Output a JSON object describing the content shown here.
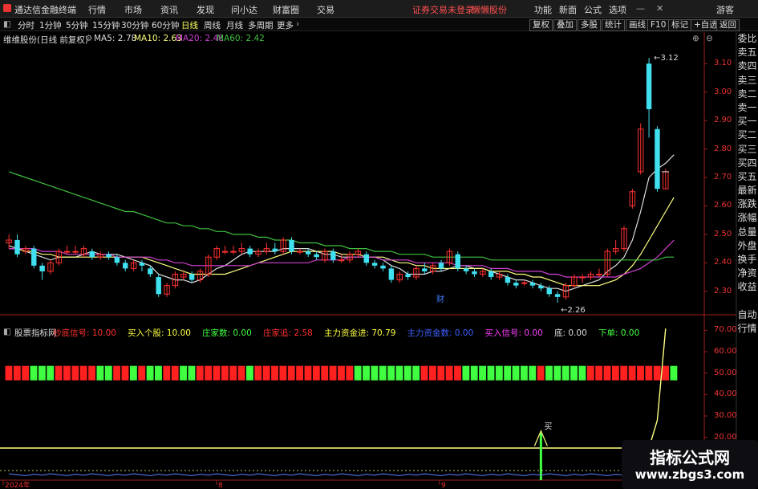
{
  "menubar": {
    "app_title": "通达信金融终端",
    "menus": [
      "行情",
      "市场",
      "资讯",
      "发现",
      "问小达",
      "财富圈",
      "交易"
    ],
    "status_text": "证券交易未登录",
    "user_text": "懒懒股份",
    "right_items": [
      "功能",
      "新面",
      "公式",
      "选项"
    ],
    "guest": "游客"
  },
  "tabs": {
    "periods": [
      "分时",
      "1分钟",
      "5分钟",
      "15分钟",
      "30分钟",
      "60分钟",
      "日线",
      "周线",
      "月线",
      "多周期",
      "更多"
    ],
    "active": "日线",
    "right_buttons": [
      "复权",
      "叠加",
      "多股",
      "统计",
      "画线",
      "F10",
      "标记",
      "+自选",
      "返回"
    ]
  },
  "infobar": {
    "stock": "维维股份(日线 前复权)",
    "ma5": "MA5: 2.78",
    "ma10": "MA10: 2.63",
    "ma20": "MA20: 2.48",
    "ma60": "MA60: 2.42"
  },
  "sidepanel": [
    "委比",
    "卖五",
    "卖四",
    "卖三",
    "卖二",
    "卖一",
    "买一",
    "买二",
    "买三",
    "买四",
    "买五",
    "最新",
    "涨跌",
    "涨幅",
    "总量",
    "外盘",
    "换手",
    "净资",
    "收益"
  ],
  "sidepanel2": [
    "自动",
    "行情"
  ],
  "indicator": {
    "name": "股票指标网",
    "items": [
      {
        "label": "抄底信号:",
        "value": "10.00",
        "color": "#ff3030"
      },
      {
        "label": "买入个股:",
        "value": "10.00",
        "color": "#ffff40"
      },
      {
        "label": "庄家数:",
        "value": "0.00",
        "color": "#40ff40"
      },
      {
        "label": "庄家追:",
        "value": "2.58",
        "color": "#ff3030"
      },
      {
        "label": "主力资金进:",
        "value": "70.79",
        "color": "#ffff40"
      },
      {
        "label": "主力资金数:",
        "value": "0.00",
        "color": "#4060ff"
      },
      {
        "label": "买入信号:",
        "value": "0.00",
        "color": "#ff40ff"
      },
      {
        "label": "底:",
        "value": "0.00",
        "color": "#dddddd"
      },
      {
        "label": "下单:",
        "value": "0.00",
        "color": "#40ff40"
      }
    ]
  },
  "price_axis": [
    "3.10",
    "3.00",
    "2.90",
    "2.80",
    "2.70",
    "2.60",
    "2.50",
    "2.40",
    "2.30"
  ],
  "ind_axis": [
    "70.00",
    "60.00",
    "50.00",
    "40.00",
    "30.00",
    "20.00"
  ],
  "annotations": {
    "high": "3.12",
    "low": "2.26",
    "cai": "财",
    "buy": "买"
  },
  "date_axis": [
    "2024年",
    "8",
    "9"
  ],
  "watermark": {
    "line1": "指标公式网",
    "line2": "www.zbgs3.com"
  },
  "colors": {
    "up": "#ff3030",
    "down": "#40e0f0",
    "ma5": "#dddddd",
    "ma10": "#ffff80",
    "ma20": "#d040d0",
    "ma60": "#40c040",
    "axis": "#ff3030"
  },
  "chart_data": {
    "type": "candlestick",
    "ylim": [
      2.24,
      3.16
    ],
    "candles": [
      [
        2.47,
        2.48,
        2.5,
        2.45
      ],
      [
        2.48,
        2.43,
        2.5,
        2.42
      ],
      [
        2.44,
        2.45,
        2.46,
        2.43
      ],
      [
        2.45,
        2.39,
        2.46,
        2.38
      ],
      [
        2.39,
        2.37,
        2.4,
        2.34
      ],
      [
        2.37,
        2.4,
        2.41,
        2.36
      ],
      [
        2.4,
        2.44,
        2.45,
        2.39
      ],
      [
        2.44,
        2.44,
        2.46,
        2.43
      ],
      [
        2.44,
        2.44,
        2.46,
        2.43
      ],
      [
        2.43,
        2.45,
        2.46,
        2.42
      ],
      [
        2.44,
        2.42,
        2.45,
        2.41
      ],
      [
        2.42,
        2.43,
        2.44,
        2.41
      ],
      [
        2.43,
        2.42,
        2.44,
        2.41
      ],
      [
        2.42,
        2.4,
        2.43,
        2.39
      ],
      [
        2.4,
        2.38,
        2.41,
        2.37
      ],
      [
        2.38,
        2.4,
        2.41,
        2.37
      ],
      [
        2.4,
        2.39,
        2.41,
        2.37
      ],
      [
        2.38,
        2.36,
        2.39,
        2.35
      ],
      [
        2.35,
        2.29,
        2.36,
        2.28
      ],
      [
        2.29,
        2.32,
        2.33,
        2.28
      ],
      [
        2.32,
        2.36,
        2.37,
        2.31
      ],
      [
        2.35,
        2.36,
        2.37,
        2.34
      ],
      [
        2.36,
        2.34,
        2.37,
        2.33
      ],
      [
        2.34,
        2.37,
        2.38,
        2.33
      ],
      [
        2.36,
        2.42,
        2.43,
        2.35
      ],
      [
        2.42,
        2.45,
        2.46,
        2.41
      ],
      [
        2.44,
        2.44,
        2.46,
        2.43
      ],
      [
        2.44,
        2.44,
        2.46,
        2.43
      ],
      [
        2.44,
        2.45,
        2.47,
        2.43
      ],
      [
        2.45,
        2.43,
        2.46,
        2.42
      ],
      [
        2.43,
        2.44,
        2.45,
        2.42
      ],
      [
        2.44,
        2.45,
        2.47,
        2.43
      ],
      [
        2.45,
        2.44,
        2.47,
        2.43
      ],
      [
        2.44,
        2.48,
        2.49,
        2.43
      ],
      [
        2.48,
        2.44,
        2.49,
        2.43
      ],
      [
        2.44,
        2.44,
        2.45,
        2.43
      ],
      [
        2.44,
        2.43,
        2.45,
        2.42
      ],
      [
        2.43,
        2.42,
        2.44,
        2.41
      ],
      [
        2.41,
        2.44,
        2.45,
        2.4
      ],
      [
        2.44,
        2.41,
        2.45,
        2.4
      ],
      [
        2.41,
        2.41,
        2.43,
        2.4
      ],
      [
        2.41,
        2.43,
        2.44,
        2.4
      ],
      [
        2.43,
        2.44,
        2.45,
        2.42
      ],
      [
        2.43,
        2.4,
        2.44,
        2.39
      ],
      [
        2.4,
        2.39,
        2.41,
        2.38
      ],
      [
        2.39,
        2.38,
        2.4,
        2.37
      ],
      [
        2.38,
        2.34,
        2.39,
        2.33
      ],
      [
        2.34,
        2.36,
        2.37,
        2.33
      ],
      [
        2.36,
        2.35,
        2.37,
        2.34
      ],
      [
        2.35,
        2.38,
        2.39,
        2.34
      ],
      [
        2.38,
        2.37,
        2.4,
        2.36
      ],
      [
        2.37,
        2.39,
        2.4,
        2.36
      ],
      [
        2.4,
        2.38,
        2.41,
        2.37
      ],
      [
        2.4,
        2.44,
        2.45,
        2.39
      ],
      [
        2.43,
        2.38,
        2.44,
        2.37
      ],
      [
        2.38,
        2.37,
        2.39,
        2.36
      ],
      [
        2.37,
        2.36,
        2.38,
        2.35
      ],
      [
        2.36,
        2.37,
        2.38,
        2.35
      ],
      [
        2.37,
        2.35,
        2.38,
        2.34
      ],
      [
        2.35,
        2.36,
        2.37,
        2.34
      ],
      [
        2.35,
        2.33,
        2.36,
        2.32
      ],
      [
        2.33,
        2.32,
        2.34,
        2.31
      ],
      [
        2.33,
        2.33,
        2.34,
        2.32
      ],
      [
        2.33,
        2.32,
        2.34,
        2.31
      ],
      [
        2.32,
        2.31,
        2.33,
        2.3
      ],
      [
        2.31,
        2.29,
        2.32,
        2.28
      ],
      [
        2.29,
        2.28,
        2.3,
        2.26
      ],
      [
        2.28,
        2.32,
        2.33,
        2.27
      ],
      [
        2.32,
        2.35,
        2.36,
        2.31
      ],
      [
        2.35,
        2.35,
        2.36,
        2.33
      ],
      [
        2.35,
        2.36,
        2.37,
        2.34
      ],
      [
        2.36,
        2.36,
        2.38,
        2.35
      ],
      [
        2.36,
        2.44,
        2.45,
        2.35
      ],
      [
        2.44,
        2.45,
        2.48,
        2.43
      ],
      [
        2.45,
        2.52,
        2.53,
        2.44
      ],
      [
        2.6,
        2.65,
        2.66,
        2.59
      ],
      [
        2.72,
        2.87,
        2.89,
        2.71
      ],
      [
        3.1,
        2.94,
        3.12,
        2.84
      ],
      [
        2.87,
        2.66,
        2.88,
        2.65
      ],
      [
        2.66,
        2.72,
        2.73,
        2.66
      ]
    ],
    "ma_series": [
      {
        "name": "MA5",
        "values": [
          2.46,
          2.45,
          2.44,
          2.43,
          2.42,
          2.41,
          2.42,
          2.42,
          2.42,
          2.43,
          2.44,
          2.43,
          2.43,
          2.43,
          2.42,
          2.41,
          2.4,
          2.39,
          2.36,
          2.35,
          2.34,
          2.34,
          2.33,
          2.34,
          2.36,
          2.38,
          2.39,
          2.41,
          2.43,
          2.44,
          2.44,
          2.44,
          2.44,
          2.45,
          2.45,
          2.45,
          2.45,
          2.44,
          2.43,
          2.43,
          2.42,
          2.42,
          2.42,
          2.42,
          2.42,
          2.41,
          2.39,
          2.38,
          2.36,
          2.36,
          2.36,
          2.37,
          2.37,
          2.38,
          2.39,
          2.39,
          2.38,
          2.38,
          2.37,
          2.36,
          2.35,
          2.34,
          2.34,
          2.33,
          2.32,
          2.31,
          2.31,
          2.3,
          2.31,
          2.32,
          2.33,
          2.34,
          2.37,
          2.39,
          2.42,
          2.48,
          2.58,
          2.7,
          2.73,
          2.75,
          2.78
        ]
      },
      {
        "name": "MA10",
        "values": [
          2.45,
          2.45,
          2.44,
          2.44,
          2.43,
          2.43,
          2.42,
          2.42,
          2.42,
          2.42,
          2.42,
          2.42,
          2.42,
          2.42,
          2.42,
          2.42,
          2.42,
          2.41,
          2.4,
          2.39,
          2.38,
          2.37,
          2.36,
          2.36,
          2.36,
          2.36,
          2.36,
          2.37,
          2.38,
          2.39,
          2.4,
          2.41,
          2.42,
          2.43,
          2.44,
          2.44,
          2.44,
          2.44,
          2.44,
          2.44,
          2.43,
          2.43,
          2.43,
          2.42,
          2.42,
          2.42,
          2.41,
          2.4,
          2.4,
          2.39,
          2.39,
          2.38,
          2.38,
          2.38,
          2.38,
          2.38,
          2.38,
          2.38,
          2.37,
          2.37,
          2.37,
          2.36,
          2.36,
          2.35,
          2.35,
          2.34,
          2.33,
          2.32,
          2.32,
          2.32,
          2.32,
          2.32,
          2.33,
          2.34,
          2.36,
          2.39,
          2.43,
          2.48,
          2.53,
          2.58,
          2.63
        ]
      },
      {
        "name": "MA20",
        "values": [
          2.45,
          2.45,
          2.45,
          2.45,
          2.44,
          2.44,
          2.44,
          2.43,
          2.43,
          2.43,
          2.43,
          2.43,
          2.43,
          2.42,
          2.42,
          2.42,
          2.42,
          2.42,
          2.41,
          2.41,
          2.4,
          2.4,
          2.39,
          2.39,
          2.39,
          2.39,
          2.39,
          2.39,
          2.39,
          2.39,
          2.4,
          2.4,
          2.4,
          2.4,
          2.4,
          2.4,
          2.4,
          2.41,
          2.41,
          2.41,
          2.41,
          2.42,
          2.42,
          2.42,
          2.42,
          2.41,
          2.41,
          2.41,
          2.41,
          2.4,
          2.4,
          2.4,
          2.4,
          2.4,
          2.39,
          2.39,
          2.39,
          2.39,
          2.38,
          2.38,
          2.38,
          2.37,
          2.37,
          2.37,
          2.37,
          2.36,
          2.36,
          2.35,
          2.35,
          2.35,
          2.35,
          2.35,
          2.35,
          2.35,
          2.36,
          2.37,
          2.38,
          2.4,
          2.42,
          2.45,
          2.48
        ]
      },
      {
        "name": "MA60",
        "values": [
          2.72,
          2.71,
          2.7,
          2.69,
          2.68,
          2.67,
          2.66,
          2.65,
          2.64,
          2.63,
          2.62,
          2.61,
          2.6,
          2.59,
          2.58,
          2.58,
          2.57,
          2.56,
          2.55,
          2.54,
          2.54,
          2.53,
          2.53,
          2.52,
          2.52,
          2.51,
          2.51,
          2.5,
          2.5,
          2.5,
          2.49,
          2.49,
          2.48,
          2.48,
          2.48,
          2.47,
          2.47,
          2.47,
          2.46,
          2.46,
          2.46,
          2.45,
          2.45,
          2.45,
          2.44,
          2.44,
          2.44,
          2.43,
          2.43,
          2.43,
          2.43,
          2.42,
          2.42,
          2.42,
          2.42,
          2.42,
          2.42,
          2.42,
          2.41,
          2.41,
          2.41,
          2.41,
          2.41,
          2.41,
          2.41,
          2.41,
          2.41,
          2.41,
          2.41,
          2.41,
          2.41,
          2.41,
          2.41,
          2.41,
          2.41,
          2.41,
          2.41,
          2.41,
          2.41,
          2.42,
          2.42
        ]
      }
    ],
    "strip_colors": "RRRGGGRRRRRGGRRGRGGRRGGRRRRRRGRRRRRRRRRRRRGGGGGGGGRRRRRGGGGGGGGGRGGGGGRRRRRRRRRRG",
    "ind_ylim": [
      0,
      75
    ],
    "signal_line": {
      "level": 15,
      "spike_start": 78,
      "spike_value": 70.79
    }
  }
}
